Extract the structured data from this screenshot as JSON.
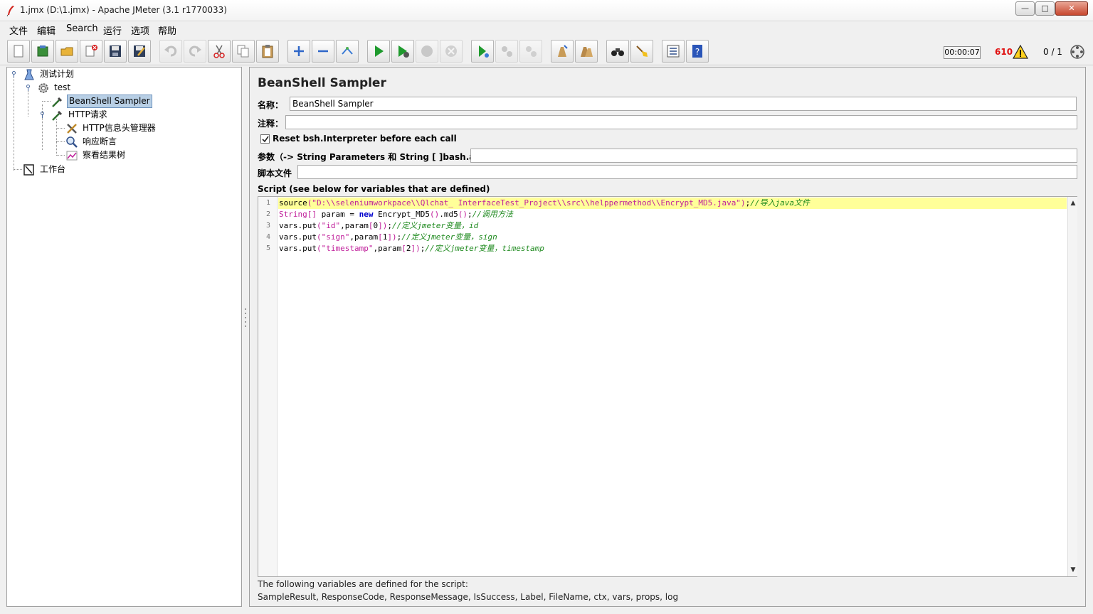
{
  "window": {
    "title": "1.jmx (D:\\1.jmx) - Apache JMeter (3.1 r1770033)",
    "minimize": "—",
    "maximize": "□",
    "close": "✕"
  },
  "menu": [
    "文件",
    "编辑",
    "Search",
    "运行",
    "选项",
    "帮助"
  ],
  "toolbar": {
    "buttons": [
      {
        "name": "new-icon"
      },
      {
        "name": "templates-icon"
      },
      {
        "name": "open-icon"
      },
      {
        "name": "close-file-icon"
      },
      {
        "name": "save-icon"
      },
      {
        "name": "save-as-icon"
      },
      {
        "name": "undo-icon"
      },
      {
        "name": "redo-icon"
      },
      {
        "name": "cut-icon"
      },
      {
        "name": "copy-icon"
      },
      {
        "name": "paste-icon"
      },
      {
        "name": "expand-icon"
      },
      {
        "name": "collapse-icon"
      },
      {
        "name": "toggle-icon"
      },
      {
        "name": "start-icon"
      },
      {
        "name": "start-no-timers-icon"
      },
      {
        "name": "stop-icon"
      },
      {
        "name": "shutdown-icon"
      },
      {
        "name": "remote-start-icon"
      },
      {
        "name": "remote-stop-icon"
      },
      {
        "name": "remote-shutdown-icon"
      },
      {
        "name": "clear-icon"
      },
      {
        "name": "clear-all-icon"
      },
      {
        "name": "search-icon"
      },
      {
        "name": "reset-search-icon"
      },
      {
        "name": "function-helper-icon"
      },
      {
        "name": "help-icon"
      }
    ],
    "timer": "00:00:07",
    "warning_count": "610",
    "threads": "0 / 1"
  },
  "tree": {
    "items": [
      {
        "label": "测试计划",
        "icon": "test-plan-icon",
        "level": 0
      },
      {
        "label": "test",
        "icon": "thread-group-icon",
        "level": 1
      },
      {
        "label": "BeanShell Sampler",
        "icon": "sampler-icon",
        "level": 2,
        "selected": true
      },
      {
        "label": "HTTP请求",
        "icon": "sampler-icon",
        "level": 2
      },
      {
        "label": "HTTP信息头管理器",
        "icon": "config-icon",
        "level": 3
      },
      {
        "label": "响应断言",
        "icon": "assertion-icon",
        "level": 3
      },
      {
        "label": "察看结果树",
        "icon": "listener-icon",
        "level": 3
      },
      {
        "label": "工作台",
        "icon": "workbench-icon",
        "level": 0
      }
    ]
  },
  "panel": {
    "title": "BeanShell Sampler",
    "name_label": "名称：",
    "name_value": "BeanShell Sampler",
    "comment_label": "注释：",
    "comment_value": "",
    "reset_label": "Reset bsh.Interpreter before each call",
    "reset_checked": true,
    "params_label": "参数（-> String Parameters 和 String [ ]bash.args）",
    "params_value": "",
    "script_file_label": "脚本文件",
    "script_file_value": "",
    "script_label": "Script (see below for variables that are defined)",
    "script_lines": [
      "source(\"D:\\\\seleniumworkpace\\\\Qlchat_ InterfaceTest_Project\\\\src\\\\helppermethod\\\\Encrypt_MD5.java\");//导入java文件",
      "String[] param = new Encrypt_MD5().md5();//调用方法",
      "vars.put(\"id\",param[0]);//定义jmeter变量，id",
      "vars.put(\"sign\",param[1]);//定义jmeter变量，sign",
      "vars.put(\"timestamp\",param[2]);//定义jmeter变量，timestamp"
    ],
    "line_numbers": [
      "1",
      "2",
      "3",
      "4",
      "5"
    ],
    "vars_title": "The following variables are defined for the script:",
    "vars_list": "SampleResult, ResponseCode, ResponseMessage, IsSuccess, Label, FileName, ctx, vars, props, log"
  }
}
